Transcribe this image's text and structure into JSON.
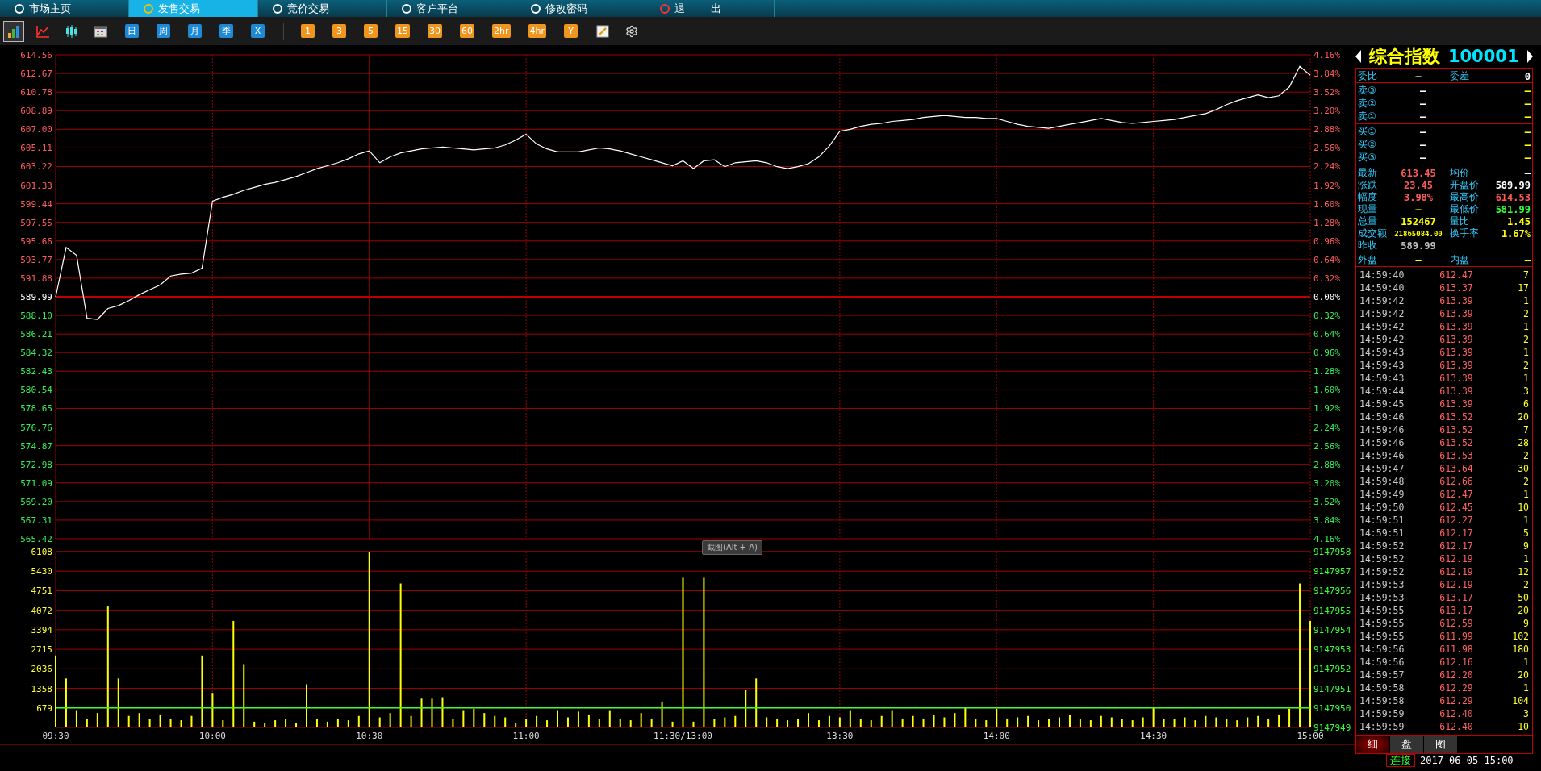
{
  "nav_tabs": [
    {
      "label": "市场主页",
      "selected": false
    },
    {
      "label": "发售交易",
      "selected": true
    },
    {
      "label": "竞价交易",
      "selected": false
    },
    {
      "label": "客户平台",
      "selected": false
    },
    {
      "label": "修改密码",
      "selected": false
    },
    {
      "label": "退 出",
      "selected": false
    }
  ],
  "toolbar": {
    "chart_type_buttons": [
      {
        "selected": true
      },
      {
        "selected": false
      },
      {
        "selected": false
      },
      {
        "selected": false
      }
    ],
    "period_buttons": [
      {
        "label": "日"
      },
      {
        "label": "周"
      },
      {
        "label": "月"
      },
      {
        "label": "季"
      },
      {
        "label": "X"
      }
    ],
    "minute_buttons": [
      {
        "label": "1"
      },
      {
        "label": "3"
      },
      {
        "label": "5"
      },
      {
        "label": "15"
      },
      {
        "label": "30"
      },
      {
        "label": "60"
      },
      {
        "label": "2hr"
      },
      {
        "label": "4hr"
      },
      {
        "label": "Y"
      }
    ]
  },
  "price_chart": {
    "right_axis_labels": [
      "4.16%",
      "3.84%",
      "3.52%",
      "3.20%",
      "2.88%",
      "2.56%",
      "2.24%",
      "1.92%",
      "1.60%",
      "1.28%",
      "0.96%",
      "0.64%",
      "0.32%",
      "0.00%",
      "0.32%",
      "0.64%",
      "0.96%",
      "1.28%",
      "1.60%",
      "1.92%",
      "2.24%",
      "2.56%",
      "2.88%",
      "3.20%",
      "3.52%",
      "3.84%",
      "4.16%"
    ],
    "chart_data": {
      "type": "line",
      "grid": true,
      "ylim": [
        565.42,
        614.56
      ],
      "ref_lines": [
        {
          "axis": "y",
          "value": 589.99
        }
      ],
      "yticks": [
        {
          "value": 614.56,
          "label": "614.56"
        },
        {
          "value": 612.67,
          "label": "612.67"
        },
        {
          "value": 610.78,
          "label": "610.78"
        },
        {
          "value": 608.89,
          "label": "608.89"
        },
        {
          "value": 607.0,
          "label": "607.00"
        },
        {
          "value": 605.11,
          "label": "605.11"
        },
        {
          "value": 603.22,
          "label": "603.22"
        },
        {
          "value": 601.33,
          "label": "601.33"
        },
        {
          "value": 599.44,
          "label": "599.44"
        },
        {
          "value": 597.55,
          "label": "597.55"
        },
        {
          "value": 595.66,
          "label": "595.66"
        },
        {
          "value": 593.77,
          "label": "593.77"
        },
        {
          "value": 591.88,
          "label": "591.88"
        },
        {
          "value": 589.99,
          "label": "589.99"
        },
        {
          "value": 588.1,
          "label": "588.10"
        },
        {
          "value": 586.21,
          "label": "586.21"
        },
        {
          "value": 584.32,
          "label": "584.32"
        },
        {
          "value": 582.43,
          "label": "582.43"
        },
        {
          "value": 580.54,
          "label": "580.54"
        },
        {
          "value": 578.65,
          "label": "578.65"
        },
        {
          "value": 576.76,
          "label": "576.76"
        },
        {
          "value": 574.87,
          "label": "574.87"
        },
        {
          "value": 572.98,
          "label": "572.98"
        },
        {
          "value": 571.09,
          "label": "571.09"
        },
        {
          "value": 569.2,
          "label": "569.20"
        },
        {
          "value": 567.31,
          "label": "567.31"
        },
        {
          "value": 565.42,
          "label": "565.42"
        }
      ],
      "categories": [
        null,
        null,
        null,
        null,
        null,
        null,
        null,
        null,
        null,
        null,
        null,
        null,
        null,
        null,
        null,
        null,
        null,
        null,
        null,
        null,
        null,
        null,
        null,
        null,
        null,
        null,
        null,
        null,
        null,
        null,
        null,
        null,
        null,
        null,
        null,
        null,
        null,
        null,
        null,
        null,
        null,
        null,
        null,
        null,
        null,
        null,
        null,
        null,
        null,
        null,
        null,
        null,
        null,
        null,
        null,
        null,
        null,
        null,
        null,
        null,
        null,
        null,
        null,
        null,
        null,
        null,
        null,
        null,
        null,
        null,
        null,
        null,
        null,
        null,
        null,
        null,
        null,
        null,
        null,
        null,
        null,
        null,
        null,
        null,
        null,
        null,
        null,
        null,
        null,
        null,
        null,
        null,
        null,
        null,
        null,
        null,
        null,
        null,
        null,
        null,
        null,
        null,
        null,
        null,
        null,
        null,
        null,
        null,
        null,
        null,
        null,
        null,
        null,
        null,
        null,
        null,
        null,
        null,
        null,
        null,
        null
      ],
      "series": [
        {
          "color": "#ffffff",
          "values": [
            589.99,
            595.0,
            594.2,
            587.8,
            587.7,
            588.8,
            589.1,
            589.6,
            590.2,
            590.7,
            591.2,
            592.1,
            592.3,
            592.4,
            592.9,
            599.7,
            600.1,
            600.4,
            600.8,
            601.1,
            601.4,
            601.6,
            601.9,
            602.2,
            602.6,
            603.0,
            603.3,
            603.6,
            604.0,
            604.5,
            604.8,
            603.6,
            604.2,
            604.6,
            604.8,
            605.0,
            605.1,
            605.2,
            605.1,
            605.0,
            604.9,
            605.0,
            605.1,
            605.4,
            605.9,
            606.5,
            605.5,
            605.0,
            604.7,
            604.7,
            604.7,
            604.9,
            605.1,
            605.0,
            604.8,
            604.5,
            604.2,
            603.9,
            603.6,
            603.3,
            603.8,
            603.0,
            603.8,
            603.9,
            603.2,
            603.6,
            603.7,
            603.8,
            603.6,
            603.2,
            603.0,
            603.2,
            603.5,
            604.2,
            605.3,
            606.8,
            607.0,
            607.3,
            607.5,
            607.6,
            607.8,
            607.9,
            608.0,
            608.2,
            608.3,
            608.4,
            608.3,
            608.2,
            608.2,
            608.1,
            608.1,
            607.8,
            607.5,
            607.3,
            607.2,
            607.1,
            607.3,
            607.5,
            607.7,
            607.9,
            608.1,
            607.9,
            607.7,
            607.6,
            607.7,
            607.8,
            607.9,
            608.0,
            608.2,
            608.4,
            608.6,
            609.0,
            609.5,
            609.9,
            610.2,
            610.5,
            610.2,
            610.4,
            611.3,
            613.4,
            612.5
          ]
        }
      ]
    }
  },
  "screenshot_hint": "截图(Alt + A)",
  "volume_chart": {
    "right_axis_labels": [
      "9147958",
      "9147957",
      "9147956",
      "9147955",
      "9147954",
      "9147953",
      "9147952",
      "9147951",
      "9147950",
      "9147949"
    ],
    "chart_data": {
      "type": "bar",
      "grid": true,
      "ylim": [
        0,
        6108
      ],
      "yticks": [
        6108,
        5430,
        4751,
        4072,
        3394,
        2715,
        2036,
        1358,
        679
      ],
      "categories": [
        "09:30",
        null,
        null,
        null,
        null,
        null,
        null,
        null,
        null,
        null,
        null,
        null,
        null,
        null,
        null,
        "10:00",
        null,
        null,
        null,
        null,
        null,
        null,
        null,
        null,
        null,
        null,
        null,
        null,
        null,
        null,
        "10:30",
        null,
        null,
        null,
        null,
        null,
        null,
        null,
        null,
        null,
        null,
        null,
        null,
        null,
        null,
        "11:00",
        null,
        null,
        null,
        null,
        null,
        null,
        null,
        null,
        null,
        null,
        null,
        null,
        null,
        null,
        "11:30/13:00",
        null,
        null,
        null,
        null,
        null,
        null,
        null,
        null,
        null,
        null,
        null,
        null,
        null,
        null,
        "13:30",
        null,
        null,
        null,
        null,
        null,
        null,
        null,
        null,
        null,
        null,
        null,
        null,
        null,
        null,
        "14:00",
        null,
        null,
        null,
        null,
        null,
        null,
        null,
        null,
        null,
        null,
        null,
        null,
        null,
        null,
        "14:30",
        null,
        null,
        null,
        null,
        null,
        null,
        null,
        null,
        null,
        null,
        null,
        null,
        null,
        null,
        "15:00"
      ],
      "ref_lines": [
        {
          "axis": "y",
          "value": 679
        }
      ],
      "series": [
        {
          "color": "#ffff00",
          "values": [
            2500,
            1700,
            600,
            300,
            500,
            4200,
            1700,
            400,
            500,
            300,
            450,
            300,
            250,
            400,
            2500,
            1200,
            250,
            3700,
            2200,
            200,
            150,
            250,
            300,
            150,
            1500,
            300,
            200,
            300,
            250,
            400,
            6100,
            350,
            500,
            5000,
            400,
            1000,
            1000,
            1050,
            300,
            600,
            650,
            500,
            400,
            350,
            150,
            300,
            400,
            250,
            600,
            350,
            550,
            450,
            300,
            600,
            300,
            250,
            500,
            300,
            900,
            200,
            5200,
            200,
            5200,
            300,
            350,
            400,
            1300,
            1700,
            350,
            300,
            250,
            300,
            500,
            250,
            400,
            350,
            600,
            300,
            250,
            400,
            600,
            300,
            400,
            300,
            450,
            350,
            500,
            700,
            300,
            250,
            650,
            300,
            350,
            400,
            250,
            300,
            350,
            450,
            300,
            250,
            400,
            350,
            300,
            250,
            350,
            700,
            300,
            300,
            350,
            250,
            400,
            350,
            300,
            250,
            350,
            400,
            300,
            450,
            650,
            5000,
            3700
          ]
        }
      ]
    }
  },
  "quote": {
    "name": "综合指数",
    "code": "100001",
    "ratio_row": [
      {
        "label": "委比",
        "value": "—"
      },
      {
        "label": "委差",
        "value": "0"
      }
    ],
    "asks": [
      {
        "label": "卖③",
        "price": "—",
        "volume": "—"
      },
      {
        "label": "卖②",
        "price": "—",
        "volume": "—"
      },
      {
        "label": "卖①",
        "price": "—",
        "volume": "—"
      }
    ],
    "bids": [
      {
        "label": "买①",
        "price": "—",
        "volume": "—"
      },
      {
        "label": "买②",
        "price": "—",
        "volume": "—"
      },
      {
        "label": "买③",
        "price": "—",
        "volume": "—"
      }
    ],
    "stats": [
      {
        "label": "最新",
        "value": "613.45",
        "color": "#ff5a5a"
      },
      {
        "label": "均价",
        "value": "—",
        "color": "#ffffff"
      },
      {
        "label": "涨跌",
        "value": "23.45",
        "color": "#ff5a5a"
      },
      {
        "label": "开盘价",
        "value": "589.99",
        "color": "#ffffff"
      },
      {
        "label": "幅度",
        "value": "3.98%",
        "color": "#ff5a5a"
      },
      {
        "label": "最高价",
        "value": "614.53",
        "color": "#ff5a5a"
      },
      {
        "label": "现量",
        "value": "—",
        "color": "#ffff00"
      },
      {
        "label": "最低价",
        "value": "581.99",
        "color": "#33ff33"
      },
      {
        "label": "总量",
        "value": "152467",
        "color": "#ffff00"
      },
      {
        "label": "量比",
        "value": "1.45",
        "color": "#ffff00"
      },
      {
        "label": "成交额",
        "value": "21865084.00",
        "color": "#ffff00"
      },
      {
        "label": "换手率",
        "value": "1.67%",
        "color": "#ffff00"
      },
      {
        "label": "昨收",
        "value": "589.99",
        "color": "#c0c0c0"
      }
    ],
    "outer_inner": [
      {
        "label": "外盘",
        "value": "—"
      },
      {
        "label": "内盘",
        "value": "—"
      }
    ]
  },
  "ticks": [
    {
      "time": "14:59:40",
      "price": "612.47",
      "volume": "7"
    },
    {
      "time": "14:59:40",
      "price": "613.37",
      "volume": "17"
    },
    {
      "time": "14:59:42",
      "price": "613.39",
      "volume": "1"
    },
    {
      "time": "14:59:42",
      "price": "613.39",
      "volume": "2"
    },
    {
      "time": "14:59:42",
      "price": "613.39",
      "volume": "1"
    },
    {
      "time": "14:59:42",
      "price": "613.39",
      "volume": "2"
    },
    {
      "time": "14:59:43",
      "price": "613.39",
      "volume": "1"
    },
    {
      "time": "14:59:43",
      "price": "613.39",
      "volume": "2"
    },
    {
      "time": "14:59:43",
      "price": "613.39",
      "volume": "1"
    },
    {
      "time": "14:59:44",
      "price": "613.39",
      "volume": "3"
    },
    {
      "time": "14:59:45",
      "price": "613.39",
      "volume": "6"
    },
    {
      "time": "14:59:46",
      "price": "613.52",
      "volume": "20"
    },
    {
      "time": "14:59:46",
      "price": "613.52",
      "volume": "7"
    },
    {
      "time": "14:59:46",
      "price": "613.52",
      "volume": "28"
    },
    {
      "time": "14:59:46",
      "price": "613.53",
      "volume": "2"
    },
    {
      "time": "14:59:47",
      "price": "613.64",
      "volume": "30"
    },
    {
      "time": "14:59:48",
      "price": "612.66",
      "volume": "2"
    },
    {
      "time": "14:59:49",
      "price": "612.47",
      "volume": "1"
    },
    {
      "time": "14:59:50",
      "price": "612.45",
      "volume": "10"
    },
    {
      "time": "14:59:51",
      "price": "612.27",
      "volume": "1"
    },
    {
      "time": "14:59:51",
      "price": "612.17",
      "volume": "5"
    },
    {
      "time": "14:59:52",
      "price": "612.17",
      "volume": "9"
    },
    {
      "time": "14:59:52",
      "price": "612.19",
      "volume": "1"
    },
    {
      "time": "14:59:52",
      "price": "612.19",
      "volume": "12"
    },
    {
      "time": "14:59:53",
      "price": "612.19",
      "volume": "2"
    },
    {
      "time": "14:59:53",
      "price": "613.17",
      "volume": "50"
    },
    {
      "time": "14:59:55",
      "price": "613.17",
      "volume": "20"
    },
    {
      "time": "14:59:55",
      "price": "612.59",
      "volume": "9"
    },
    {
      "time": "14:59:55",
      "price": "611.99",
      "volume": "102"
    },
    {
      "time": "14:59:56",
      "price": "611.98",
      "volume": "180"
    },
    {
      "time": "14:59:56",
      "price": "612.16",
      "volume": "1"
    },
    {
      "time": "14:59:57",
      "price": "612.20",
      "volume": "20"
    },
    {
      "time": "14:59:58",
      "price": "612.29",
      "volume": "1"
    },
    {
      "time": "14:59:58",
      "price": "612.29",
      "volume": "104"
    },
    {
      "time": "14:59:59",
      "price": "612.40",
      "volume": "3"
    },
    {
      "time": "14:59:59",
      "price": "612.40",
      "volume": "10"
    }
  ],
  "panel_tabs": [
    {
      "label": "细",
      "selected": true
    },
    {
      "label": "盘",
      "selected": false
    },
    {
      "label": "图",
      "selected": false
    }
  ],
  "status": {
    "connection": "连接",
    "datetime": "2017-06-05 15:00"
  }
}
